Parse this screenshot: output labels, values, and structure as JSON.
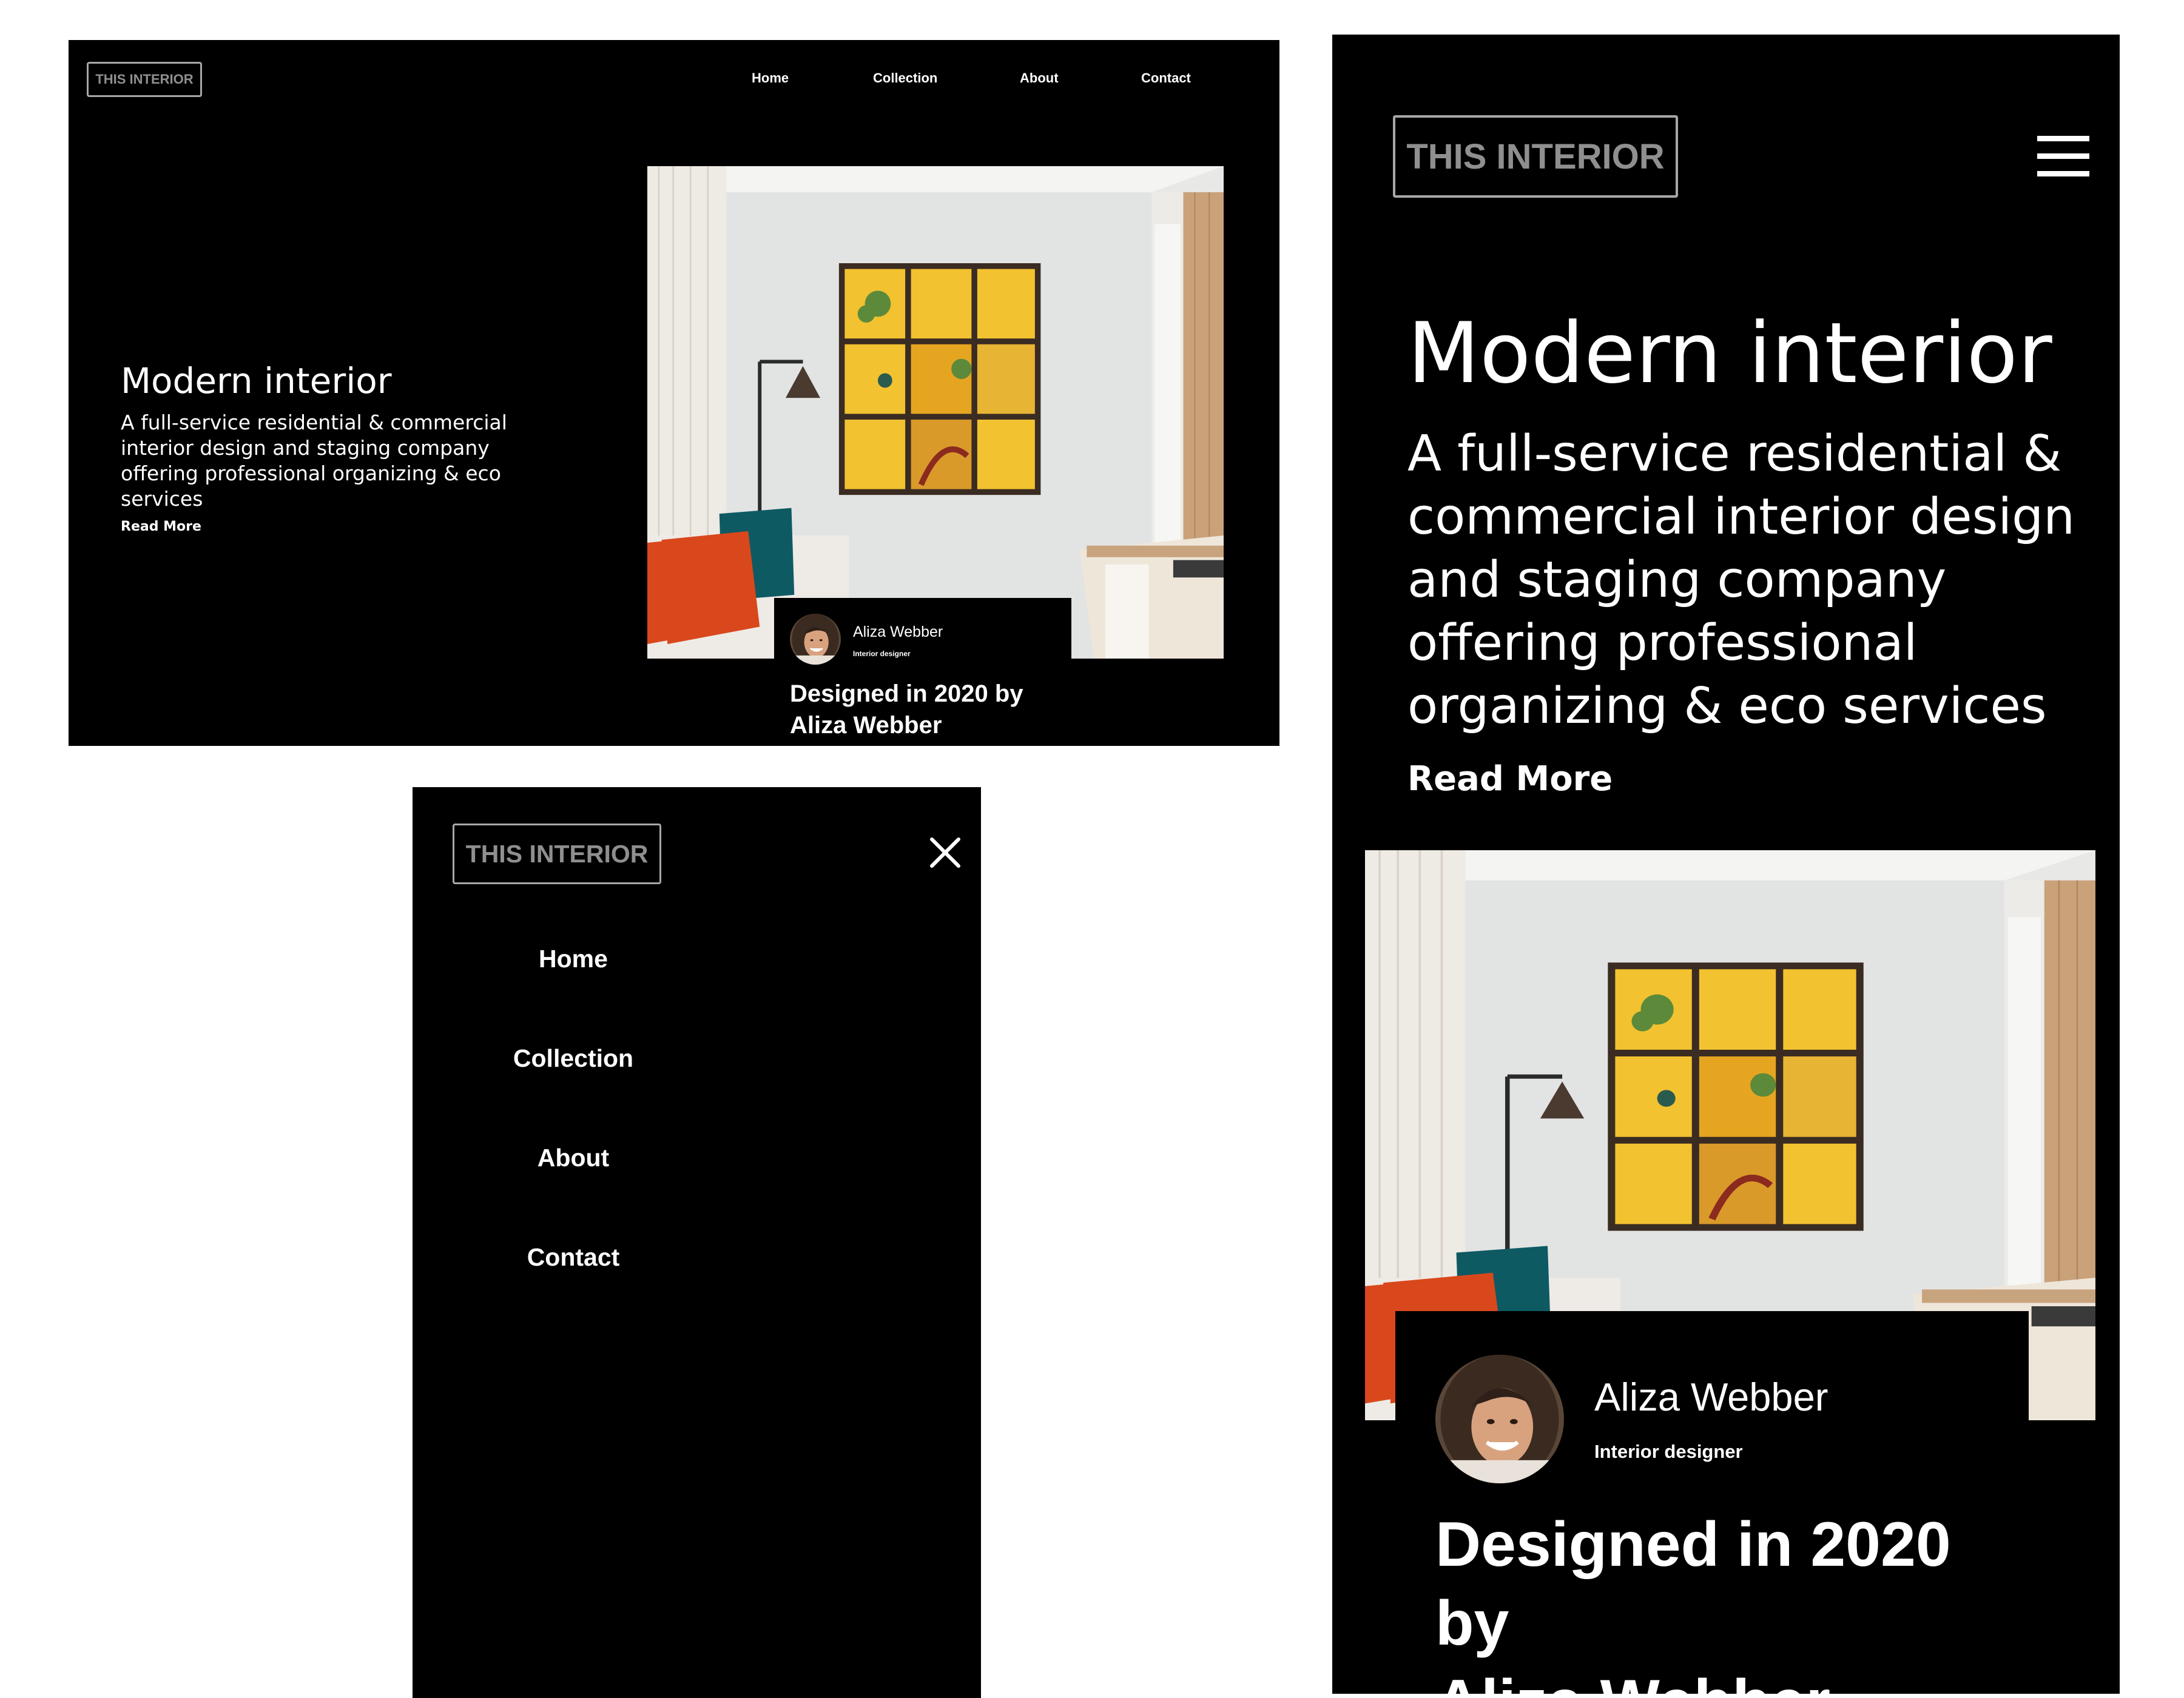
{
  "brand": {
    "logo_text": "THIS INTERIOR"
  },
  "nav": {
    "items": [
      "Home",
      "Collection",
      "About",
      "Contact"
    ]
  },
  "hero": {
    "title": "Modern interior",
    "subtitle_lines_desktop": [
      "A full-service residential & commercial",
      "interior design and staging company",
      "offering professional organizing & eco",
      "services"
    ],
    "subtitle_lines_mobile": [
      "A full-service residential &",
      "commercial interior design",
      "and staging company",
      "offering professional",
      "organizing & eco services"
    ],
    "read_more": "Read More"
  },
  "designer": {
    "name": "Aliza Webber",
    "role": "Interior designer",
    "caption_lines": [
      "Designed in 2020 by",
      "Aliza Webber"
    ]
  },
  "icons": {
    "menu": "hamburger-menu-icon",
    "close": "close-icon"
  },
  "colors": {
    "background": "#000000",
    "text": "#ffffff",
    "logo_border": "#a8a8a8",
    "logo_text": "#8f8f8f",
    "art_yellow": "#f2c230",
    "pillow_orange": "#d9481c",
    "pillow_teal": "#0e5a63"
  }
}
